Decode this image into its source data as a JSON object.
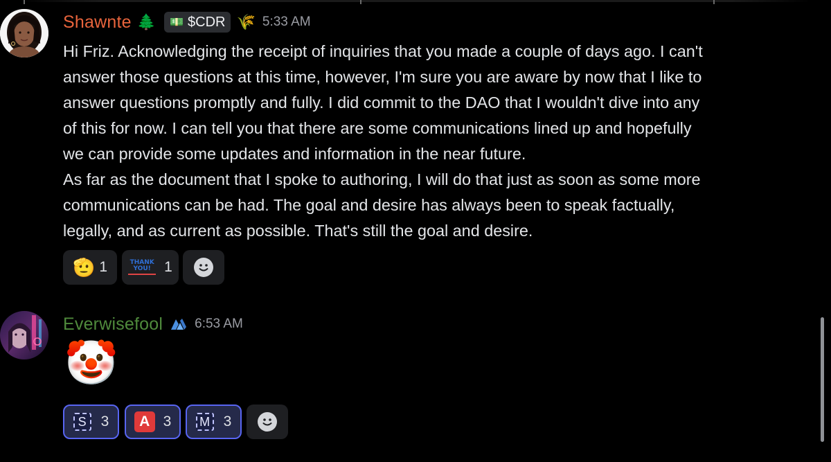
{
  "messages": [
    {
      "username": "Shawnte",
      "username_color": "#e8643c",
      "badge_emoji": "🌲",
      "role_tag": "$CDR",
      "role_icon_emoji": "💵",
      "extra_badge_emoji": "🌾",
      "timestamp": "5:33 AM",
      "lines": [
        "Hi Friz. Acknowledging the receipt of inquiries that you made a couple of days ago. I can't",
        "answer those questions at this time, however, I'm sure you are aware by now that I like to",
        "answer questions promptly and fully. I did commit to the DAO that I wouldn't dive into any",
        "of this for now. I can tell you that there are some communications lined up and hopefully",
        "we can provide some updates and information in the near future.",
        "As far as the document that I spoke to authoring, I will do that just as soon as some more",
        "communications can be had. The goal and desire has always been to speak factually,",
        "legally, and as current as possible. That's still the goal and desire."
      ],
      "reactions": [
        {
          "emoji": "🫡",
          "count": "1"
        },
        {
          "emoji": "THANK YOU!",
          "count": "1"
        }
      ]
    },
    {
      "username": "Everwisefool",
      "username_color": "#4f8a3c",
      "badge_icon": "nitro-rank-icon",
      "timestamp": "6:53 AM",
      "emoji": "🤡",
      "reactions": [
        {
          "key": "S",
          "count": "3"
        },
        {
          "key": "A",
          "count": "3"
        },
        {
          "key": "M",
          "count": "3"
        }
      ]
    }
  ],
  "accent_color": "#5865f2"
}
